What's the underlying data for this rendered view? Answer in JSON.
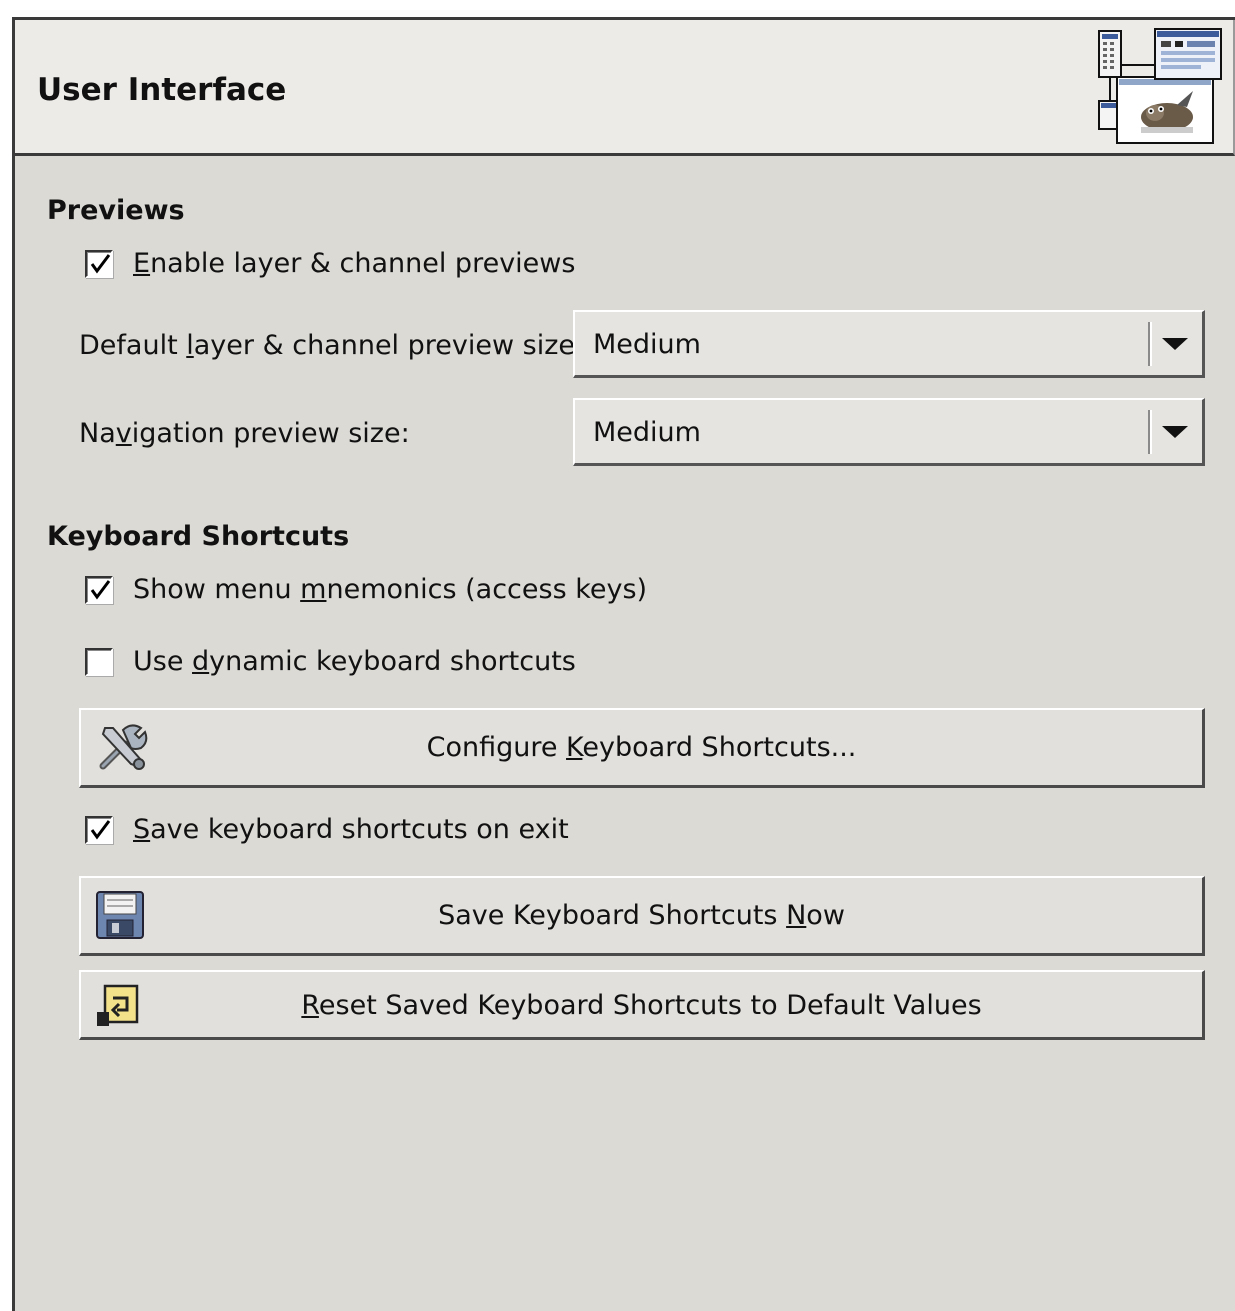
{
  "header": {
    "title": "User Interface",
    "icon": "gimp-preferences-interface-icon"
  },
  "previews": {
    "section_title": "Previews",
    "enable_previews": {
      "label_underline": "E",
      "label_rest": "nable layer & channel previews",
      "checked": true
    },
    "default_size": {
      "label_before": "Default ",
      "label_underline": "l",
      "label_after": "ayer & channel preview size:",
      "value": "Medium"
    },
    "navigation_size": {
      "label_before": "Na",
      "label_underline": "v",
      "label_after": "igation preview size:",
      "value": "Medium"
    }
  },
  "keyboard": {
    "section_title": "Keyboard Shortcuts",
    "show_mnemonics": {
      "label_before": "Show menu ",
      "label_underline": "m",
      "label_after": "nemonics (access keys)",
      "checked": true
    },
    "dynamic_shortcuts": {
      "label_before": "Use ",
      "label_underline": "d",
      "label_after": "ynamic keyboard shortcuts",
      "checked": false
    },
    "configure_button": {
      "label_before": "Configure ",
      "label_underline": "K",
      "label_after": "eyboard Shortcuts...",
      "icon": "tools-icon"
    },
    "save_on_exit": {
      "label_underline": "S",
      "label_rest": "ave keyboard shortcuts on exit",
      "checked": true
    },
    "save_now_button": {
      "label_before": "Save Keyboard Shortcuts ",
      "label_underline": "N",
      "label_after": "ow",
      "icon": "floppy-disk-icon"
    },
    "reset_button": {
      "label_underline": "R",
      "label_rest": "eset Saved Keyboard Shortcuts to Default Values",
      "icon": "reset-icon"
    }
  }
}
